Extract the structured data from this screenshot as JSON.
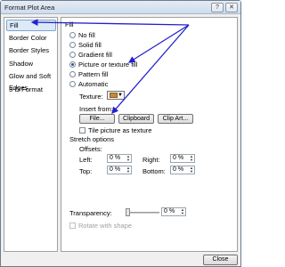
{
  "window": {
    "title": "Format Plot Area",
    "help_glyph": "?",
    "close_glyph": "✕"
  },
  "nav": {
    "items": [
      {
        "label": "Fill",
        "selected": true
      },
      {
        "label": "Border Color",
        "selected": false
      },
      {
        "label": "Border Styles",
        "selected": false
      },
      {
        "label": "Shadow",
        "selected": false
      },
      {
        "label": "Glow and Soft Edges",
        "selected": false
      },
      {
        "label": "3-D Format",
        "selected": false
      }
    ]
  },
  "fill": {
    "heading": "Fill",
    "options": [
      {
        "label": "No fill",
        "checked": false
      },
      {
        "label": "Solid fill",
        "checked": false
      },
      {
        "label": "Gradient fill",
        "checked": false
      },
      {
        "label": "Picture or texture fill",
        "checked": true
      },
      {
        "label": "Pattern fill",
        "checked": false
      },
      {
        "label": "Automatic",
        "checked": false
      }
    ],
    "texture_label": "Texture:",
    "insert_from_label": "Insert from:",
    "file_button": "File...",
    "clipboard_button": "Clipboard",
    "clip_art_button": "Clip Art...",
    "tile_label": "Tile picture as texture",
    "stretch_options_label": "Stretch options",
    "offsets_label": "Offsets:",
    "left_label": "Left:",
    "left_value": "0 %",
    "right_label": "Right:",
    "right_value": "0 %",
    "top_label": "Top:",
    "top_value": "0 %",
    "bottom_label": "Bottom:",
    "bottom_value": "0 %",
    "transparency_label": "Transparency:",
    "transparency_value": "0 %",
    "transparency_level": 0,
    "rotate_label": "Rotate with shape"
  },
  "footer": {
    "close_button": "Close"
  },
  "colors": {
    "annotation_arrow": "#2222cc",
    "selection_fill": "#dceaf8",
    "selection_border": "#7da2ce",
    "texture_swatch": "#c58b3d"
  }
}
